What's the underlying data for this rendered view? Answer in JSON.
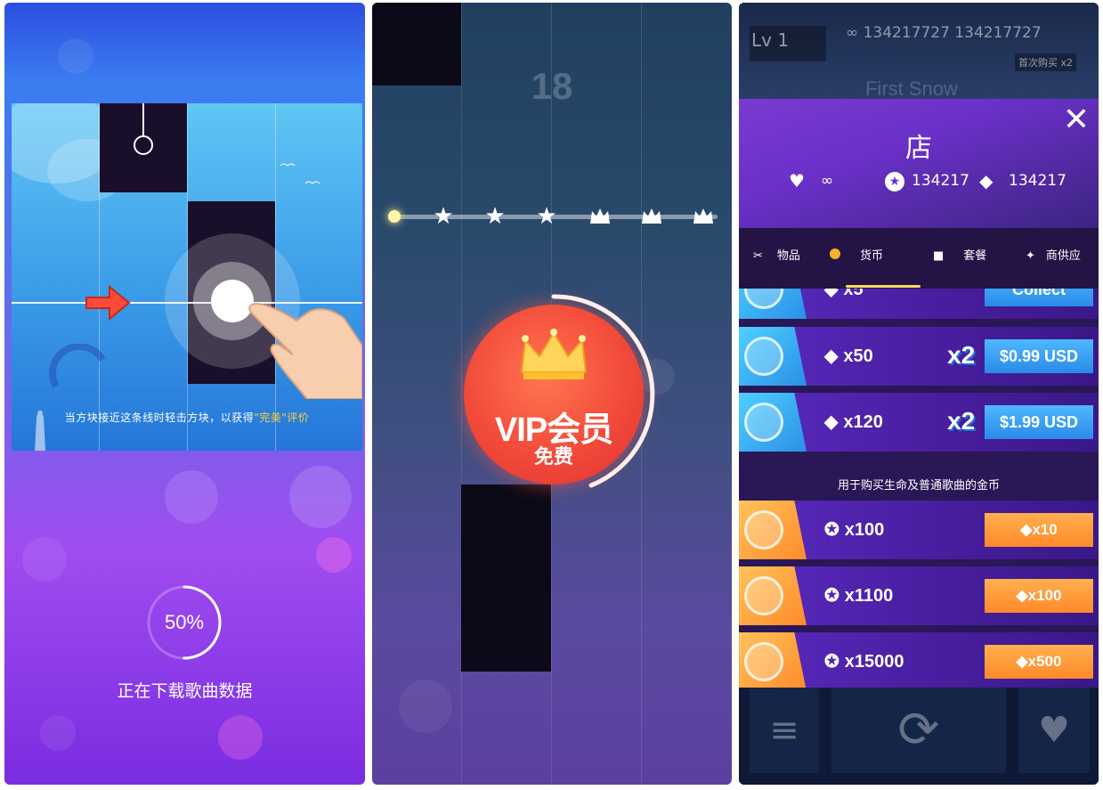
{
  "panel1": {
    "tutorial_text_prefix": "当方块接近这条线时轻击方块，以获得",
    "tutorial_text_highlight": "\"完美\"",
    "tutorial_text_suffix": "评价",
    "loading_percent": "50%",
    "loading_progress": 0.5,
    "loading_text": "正在下载歌曲数据"
  },
  "panel2": {
    "score": "18",
    "progress_icons": [
      "star-icon",
      "star-icon",
      "star-icon",
      "crown-icon",
      "crown-icon",
      "crown-icon"
    ],
    "vip_label": "VIP会员",
    "vip_sub": "免费"
  },
  "panel3": {
    "level": "Lv 1",
    "top_stats": "∞ 134217727 134217727",
    "first_buy": "首次购买 x2",
    "song_title": "First Snow",
    "shop_title": "店",
    "lives": "∞",
    "coins": "134217",
    "diamonds": "134217",
    "tabs": [
      {
        "label": "物品",
        "icon": "item-icon"
      },
      {
        "label": "货币",
        "icon": "coin-icon",
        "active": true
      },
      {
        "label": "套餐",
        "icon": "package-icon"
      },
      {
        "label": "商供应",
        "icon": "sparkle-icon"
      }
    ],
    "diamond_rows": [
      {
        "qty": "x5",
        "button": "Collect"
      },
      {
        "qty": "x50",
        "bonus": "x2",
        "button": "$0.99 USD"
      },
      {
        "qty": "x120",
        "bonus": "x2",
        "button": "$1.99 USD"
      }
    ],
    "coin_section_label": "用于购买生命及普通歌曲的金币",
    "coin_rows": [
      {
        "qty": "x100",
        "button": "x10"
      },
      {
        "qty": "x1100",
        "button": "x100"
      },
      {
        "qty": "x15000",
        "button": "x500"
      }
    ],
    "bottom_icons": [
      "menu-icon",
      "refresh-icon",
      "heart-icon"
    ]
  },
  "colors": {
    "accent_blue": "#2a8ae8",
    "accent_orange": "#ff8a2a",
    "vip_red": "#f24a3a",
    "highlight_yellow": "#ffd23a"
  }
}
